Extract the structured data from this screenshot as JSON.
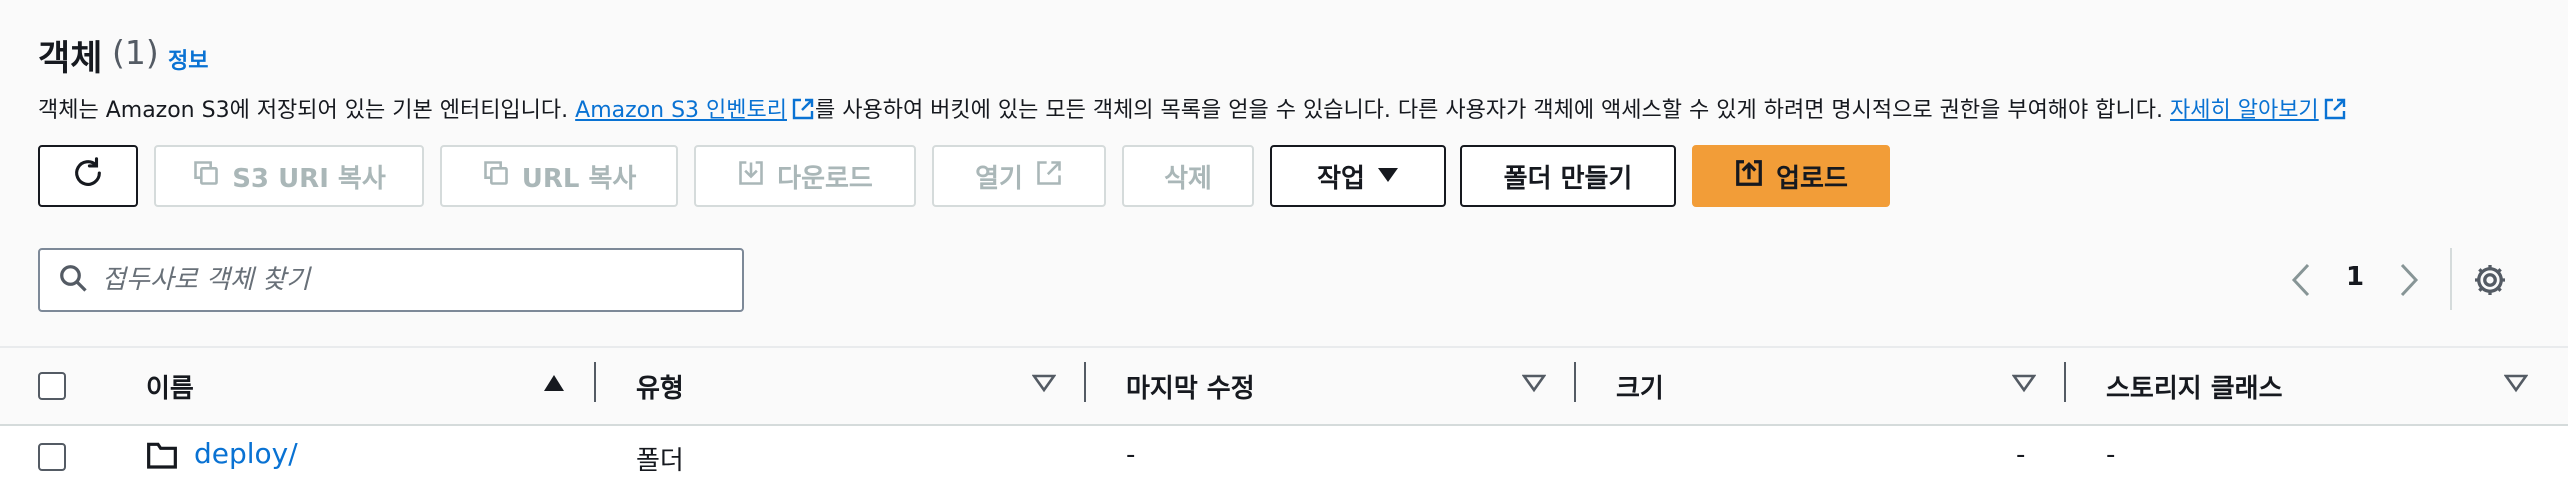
{
  "header": {
    "title": "객체",
    "count": "(1)",
    "info_link": "정보"
  },
  "description": {
    "before": "객체는 Amazon S3에 저장되어 있는 기본 엔터티입니다. ",
    "inventory_link": "Amazon S3 인벤토리",
    "middle": "를 사용하여 버킷에 있는 모든 객체의 목록을 얻을 수 있습니다. 다른 사용자가 객체에 액세스할 수 있게 하려면 명시적으로 권한을 부여해야 합니다. ",
    "learn_more_link": "자세히 알아보기"
  },
  "toolbar": {
    "copy_s3_uri": "S3 URI 복사",
    "copy_url": "URL 복사",
    "download": "다운로드",
    "open": "열기",
    "delete": "삭제",
    "actions": "작업",
    "create_folder": "폴더 만들기",
    "upload": "업로드"
  },
  "search": {
    "placeholder": "접두사로 객체 찾기",
    "value": ""
  },
  "pagination": {
    "current_page": "1"
  },
  "table": {
    "columns": [
      "이름",
      "유형",
      "마지막 수정",
      "크기",
      "스토리지 클래스"
    ],
    "rows": [
      {
        "name": "deploy/",
        "type": "폴더",
        "last_modified": "-",
        "size": "-",
        "storage_class": "-"
      }
    ]
  },
  "colors": {
    "link": "#0972d3",
    "primary_button": "#f29d38",
    "disabled_text": "#aab7b8",
    "text": "#16191f"
  }
}
